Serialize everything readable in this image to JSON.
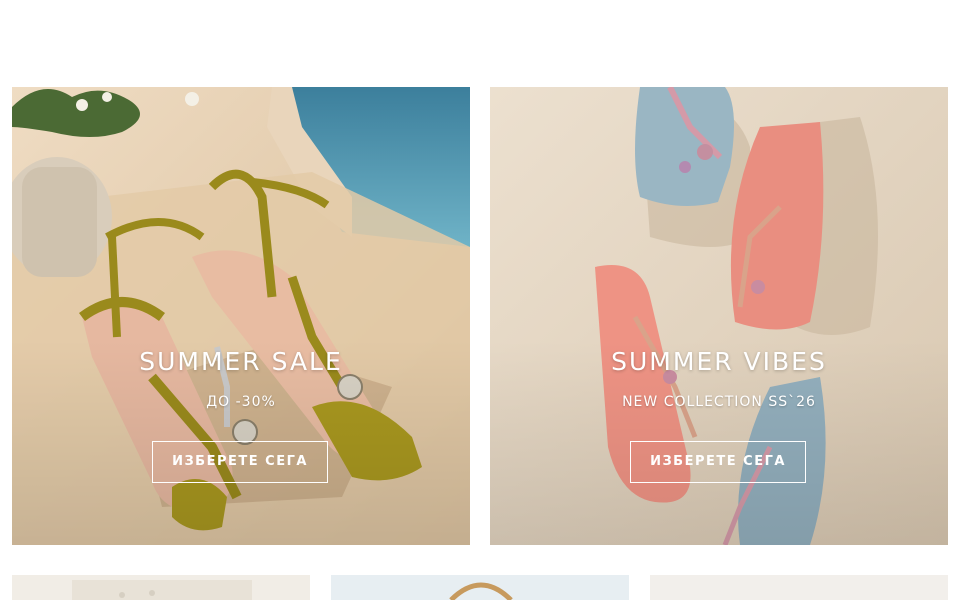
{
  "promos": [
    {
      "title": "SUMMER SALE",
      "subtitle": "ДО -30%",
      "cta_label": "ИЗБЕРЕТЕ СЕГА",
      "image_icon": "strappy-heeled-sandals"
    },
    {
      "title": "SUMMER VIBES",
      "subtitle": "NEW COLLECTION SS`26",
      "cta_label": "ИЗБЕРЕТЕ СЕГА",
      "image_icon": "embellished-flip-flops"
    }
  ],
  "bottom_cards": [
    {
      "image_icon": "lace-garment-image"
    },
    {
      "image_icon": "woven-bag-image"
    },
    {
      "image_icon": "neutral-product-image"
    }
  ],
  "colors": {
    "text_on_image": "#ffffff",
    "page_background": "#ffffff"
  }
}
